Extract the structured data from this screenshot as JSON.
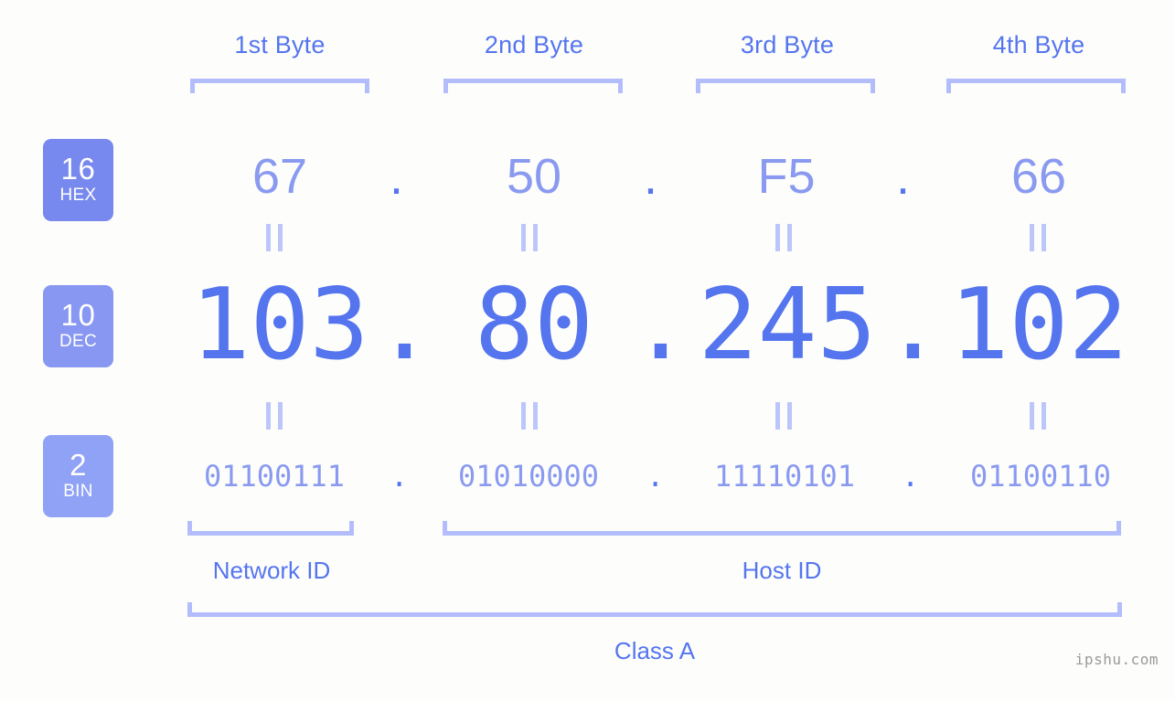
{
  "colors": {
    "background": "#fdfefb",
    "accent_strong": "#5575ef",
    "accent_light": "#8a9af0",
    "bracket": "#b3bdfb",
    "badge_hex": "#7788ee",
    "badge_dec": "#8797f2",
    "badge_bin": "#90a2f6",
    "watermark": "#9a9a9a"
  },
  "byte_headers": [
    {
      "label": "1st Byte"
    },
    {
      "label": "2nd Byte"
    },
    {
      "label": "3rd Byte"
    },
    {
      "label": "4th Byte"
    }
  ],
  "badges": [
    {
      "base": "16",
      "name": "HEX"
    },
    {
      "base": "10",
      "name": "DEC"
    },
    {
      "base": "2",
      "name": "BIN"
    }
  ],
  "rows": {
    "hex": {
      "values": [
        "67",
        "50",
        "F5",
        "66"
      ],
      "separators": [
        ".",
        ".",
        "."
      ]
    },
    "dec": {
      "values": [
        "103",
        "80",
        "245",
        "102"
      ],
      "separators": [
        ".",
        ".",
        "."
      ]
    },
    "bin": {
      "values": [
        "01100111",
        "01010000",
        "11110101",
        "01100110"
      ],
      "separators": [
        ".",
        ".",
        "."
      ]
    }
  },
  "equals_symbol": "=",
  "segments": {
    "network_id": "Network ID",
    "host_id": "Host ID",
    "class": "Class A"
  },
  "watermark": "ipshu.com"
}
